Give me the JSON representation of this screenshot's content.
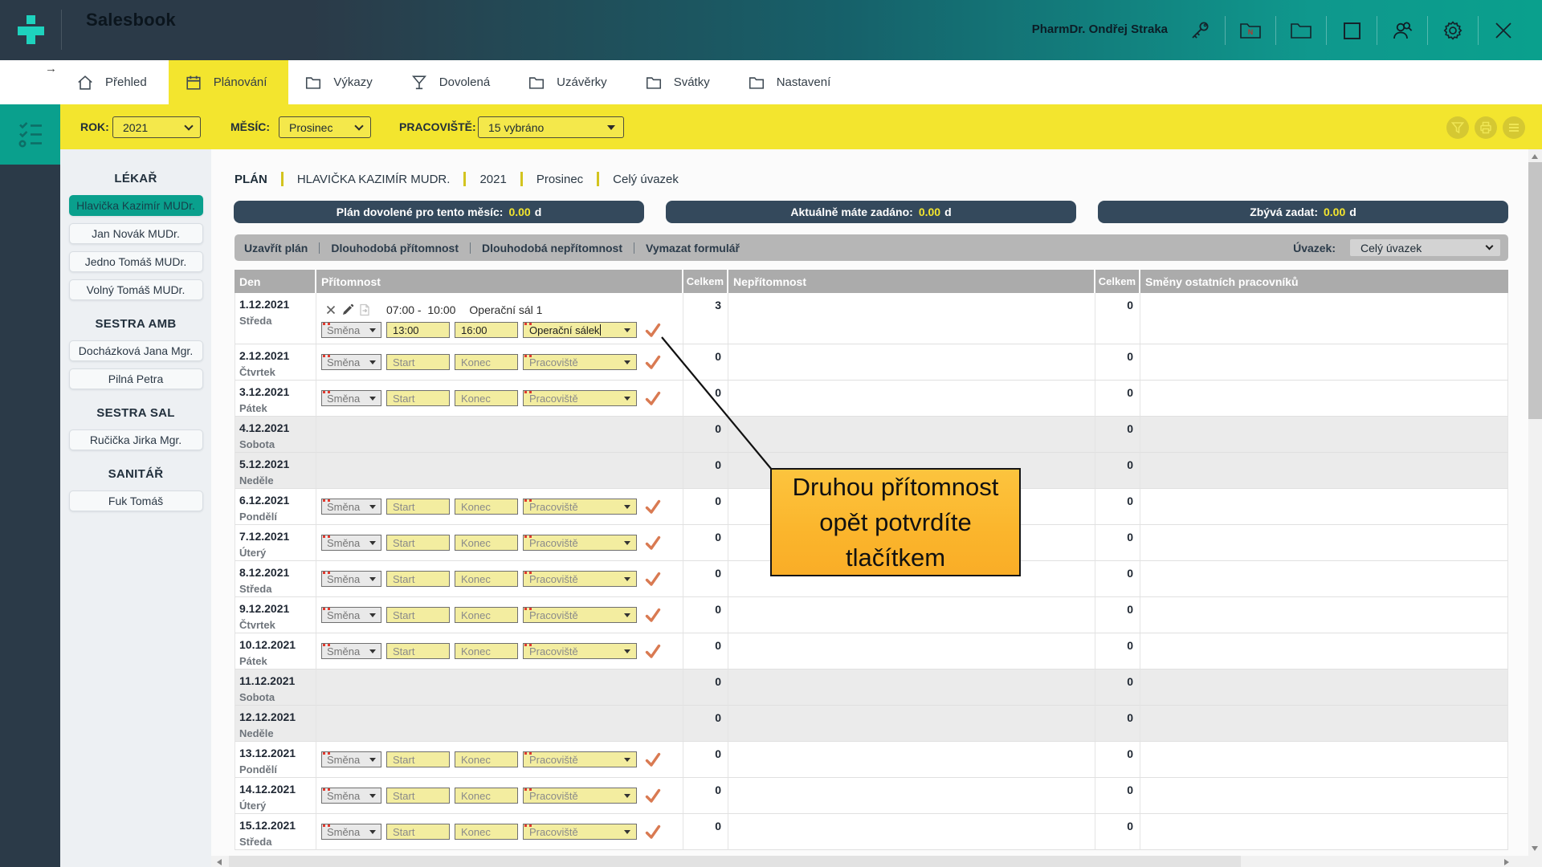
{
  "colors": {
    "accent_teal": "#0aa08d",
    "bright_yellow": "#f3e52e",
    "dark_navy": "#2b3a48",
    "banner_navy": "#34495c",
    "callout_amber": "#fbb52c",
    "check_orange": "#d97a52",
    "logo_mint": "#1ed2bd"
  },
  "header": {
    "app_title": "Salesbook",
    "user_name": "PharmDr. Ondřej Straka",
    "icons": [
      "key-icon",
      "folder-n-icon",
      "folder-icon",
      "square-icon",
      "user-search-icon",
      "gear-icon",
      "close-icon"
    ]
  },
  "nav": {
    "back_arrow": "→",
    "tabs": [
      {
        "label": "Přehled",
        "icon": "home-icon",
        "active": false
      },
      {
        "label": "Plánování",
        "icon": "calendar-icon",
        "active": true
      },
      {
        "label": "Výkazy",
        "icon": "folder-icon",
        "active": false
      },
      {
        "label": "Dovolená",
        "icon": "martini-icon",
        "active": false
      },
      {
        "label": "Uzávěrky",
        "icon": "folder-icon",
        "active": false
      },
      {
        "label": "Svátky",
        "icon": "folder-icon",
        "active": false
      },
      {
        "label": "Nastavení",
        "icon": "folder-icon",
        "active": false
      }
    ]
  },
  "filters": {
    "rok_label": "ROK:",
    "rok_value": "2021",
    "mesic_label": "MĚSÍC:",
    "mesic_value": "Prosinec",
    "pracoviste_label": "PRACOVIŠTĚ:",
    "pracoviste_value": "15 vybráno",
    "round_buttons": [
      "filter-icon",
      "print-icon",
      "menu-icon"
    ]
  },
  "sidebar": {
    "sections": [
      {
        "title": "LÉKAŘ",
        "people": [
          {
            "name": "Hlavička Kazimír MUDr.",
            "cls": "selected"
          },
          {
            "name": "Jan Novák MUDr.",
            "cls": ""
          },
          {
            "name": "Jedno Tomáš MUDr.",
            "cls": ""
          },
          {
            "name": "Volný Tomáš MUDr.",
            "cls": ""
          }
        ]
      },
      {
        "title": "SESTRA AMB",
        "people": [
          {
            "name": "Docházková Jana Mgr.",
            "cls": ""
          },
          {
            "name": "Pilná Petra",
            "cls": ""
          }
        ]
      },
      {
        "title": "SESTRA SAL",
        "people": [
          {
            "name": "Ručička Jirka Mgr.",
            "cls": ""
          }
        ]
      },
      {
        "title": "SANITÁŘ",
        "people": [
          {
            "name": "Fuk Tomáš",
            "cls": ""
          }
        ]
      }
    ]
  },
  "breadcrumb": [
    {
      "label": "PLÁN",
      "cls": "first"
    },
    {
      "label": "HLAVIČKA KAZIMÍR MUDR.",
      "cls": ""
    },
    {
      "label": "2021",
      "cls": ""
    },
    {
      "label": "Prosinec",
      "cls": ""
    },
    {
      "label": "Celý úvazek",
      "cls": ""
    }
  ],
  "banners": [
    {
      "label": "Plán dovolené pro tento měsíc:",
      "value": "0.00",
      "unit": "d"
    },
    {
      "label": "Aktuálně máte zadáno:",
      "value": "0.00",
      "unit": "d"
    },
    {
      "label": "Zbývá zadat:",
      "value": "0.00",
      "unit": "d"
    }
  ],
  "toolbar": {
    "actions": [
      "Uzavřít plán",
      "Dlouhodobá přítomnost",
      "Dlouhodobá nepřítomnost",
      "Vymazat formulář"
    ],
    "uvazek_label": "Úvazek:",
    "uvazek_value": "Celý úvazek"
  },
  "table": {
    "headers": [
      {
        "label": "Den",
        "cls": ""
      },
      {
        "label": "Přítomnost",
        "cls": ""
      },
      {
        "label": "Celkem",
        "cls": "num"
      },
      {
        "label": "Nepřítomnost",
        "cls": ""
      },
      {
        "label": "Celkem",
        "cls": "num"
      },
      {
        "label": "Směny ostatních pracovníků",
        "cls": ""
      }
    ],
    "rows": [
      {
        "date": "1.12.2021",
        "day": "Středa",
        "row_cls": "tall",
        "has_entry": true,
        "entry": {
          "time": "07:00 -  10:00",
          "place": "Operační sál 1"
        },
        "has_form": true,
        "form": {
          "smena": "Směna",
          "start": "13:00",
          "start_cls": "val",
          "konec": "16:00",
          "konec_cls": "val",
          "pracoviste": "Operační sálek",
          "prac_cls": "val",
          "has_cursor": true
        },
        "celkem1": "3",
        "celkem2": "0"
      },
      {
        "date": "2.12.2021",
        "day": "Čtvrtek",
        "row_cls": "",
        "has_entry": false,
        "has_form": true,
        "form": {
          "smena": "Směna",
          "start": "Start",
          "start_cls": "",
          "konec": "Konec",
          "konec_cls": "",
          "pracoviste": "Pracoviště",
          "prac_cls": "",
          "has_cursor": false
        },
        "celkem1": "0",
        "celkem2": "0"
      },
      {
        "date": "3.12.2021",
        "day": "Pátek",
        "row_cls": "",
        "has_entry": false,
        "has_form": true,
        "form": {
          "smena": "Směna",
          "start": "Start",
          "start_cls": "",
          "konec": "Konec",
          "konec_cls": "",
          "pracoviste": "Pracoviště",
          "prac_cls": "",
          "has_cursor": false
        },
        "celkem1": "0",
        "celkem2": "0"
      },
      {
        "date": "4.12.2021",
        "day": "Sobota",
        "row_cls": "weekend",
        "has_entry": false,
        "has_form": false,
        "celkem1": "0",
        "celkem2": "0"
      },
      {
        "date": "5.12.2021",
        "day": "Neděle",
        "row_cls": "weekend",
        "has_entry": false,
        "has_form": false,
        "celkem1": "0",
        "celkem2": "0"
      },
      {
        "date": "6.12.2021",
        "day": "Pondělí",
        "row_cls": "",
        "has_entry": false,
        "has_form": true,
        "form": {
          "smena": "Směna",
          "start": "Start",
          "start_cls": "",
          "konec": "Konec",
          "konec_cls": "",
          "pracoviste": "Pracoviště",
          "prac_cls": "",
          "has_cursor": false
        },
        "celkem1": "0",
        "celkem2": "0"
      },
      {
        "date": "7.12.2021",
        "day": "Úterý",
        "row_cls": "",
        "has_entry": false,
        "has_form": true,
        "form": {
          "smena": "Směna",
          "start": "Start",
          "start_cls": "",
          "konec": "Konec",
          "konec_cls": "",
          "pracoviste": "Pracoviště",
          "prac_cls": "",
          "has_cursor": false
        },
        "celkem1": "0",
        "celkem2": "0"
      },
      {
        "date": "8.12.2021",
        "day": "Středa",
        "row_cls": "",
        "has_entry": false,
        "has_form": true,
        "form": {
          "smena": "Směna",
          "start": "Start",
          "start_cls": "",
          "konec": "Konec",
          "konec_cls": "",
          "pracoviste": "Pracoviště",
          "prac_cls": "",
          "has_cursor": false
        },
        "celkem1": "0",
        "celkem2": "0"
      },
      {
        "date": "9.12.2021",
        "day": "Čtvrtek",
        "row_cls": "",
        "has_entry": false,
        "has_form": true,
        "form": {
          "smena": "Směna",
          "start": "Start",
          "start_cls": "",
          "konec": "Konec",
          "konec_cls": "",
          "pracoviste": "Pracoviště",
          "prac_cls": "",
          "has_cursor": false
        },
        "celkem1": "0",
        "celkem2": "0"
      },
      {
        "date": "10.12.2021",
        "day": "Pátek",
        "row_cls": "",
        "has_entry": false,
        "has_form": true,
        "form": {
          "smena": "Směna",
          "start": "Start",
          "start_cls": "",
          "konec": "Konec",
          "konec_cls": "",
          "pracoviste": "Pracoviště",
          "prac_cls": "",
          "has_cursor": false
        },
        "celkem1": "0",
        "celkem2": "0"
      },
      {
        "date": "11.12.2021",
        "day": "Sobota",
        "row_cls": "weekend",
        "has_entry": false,
        "has_form": false,
        "celkem1": "0",
        "celkem2": "0"
      },
      {
        "date": "12.12.2021",
        "day": "Neděle",
        "row_cls": "weekend",
        "has_entry": false,
        "has_form": false,
        "celkem1": "0",
        "celkem2": "0"
      },
      {
        "date": "13.12.2021",
        "day": "Pondělí",
        "row_cls": "",
        "has_entry": false,
        "has_form": true,
        "form": {
          "smena": "Směna",
          "start": "Start",
          "start_cls": "",
          "konec": "Konec",
          "konec_cls": "",
          "pracoviste": "Pracoviště",
          "prac_cls": "",
          "has_cursor": false
        },
        "celkem1": "0",
        "celkem2": "0"
      },
      {
        "date": "14.12.2021",
        "day": "Úterý",
        "row_cls": "",
        "has_entry": false,
        "has_form": true,
        "form": {
          "smena": "Směna",
          "start": "Start",
          "start_cls": "",
          "konec": "Konec",
          "konec_cls": "",
          "pracoviste": "Pracoviště",
          "prac_cls": "",
          "has_cursor": false
        },
        "celkem1": "0",
        "celkem2": "0"
      },
      {
        "date": "15.12.2021",
        "day": "Středa",
        "row_cls": "",
        "has_entry": false,
        "has_form": true,
        "form": {
          "smena": "Směna",
          "start": "Start",
          "start_cls": "",
          "konec": "Konec",
          "konec_cls": "",
          "pracoviste": "Pracoviště",
          "prac_cls": "",
          "has_cursor": false
        },
        "celkem1": "0",
        "celkem2": "0"
      }
    ]
  },
  "callout": {
    "lines": [
      "Druhou přítomnost",
      "opět potvrdíte",
      "tlačítkem"
    ]
  }
}
